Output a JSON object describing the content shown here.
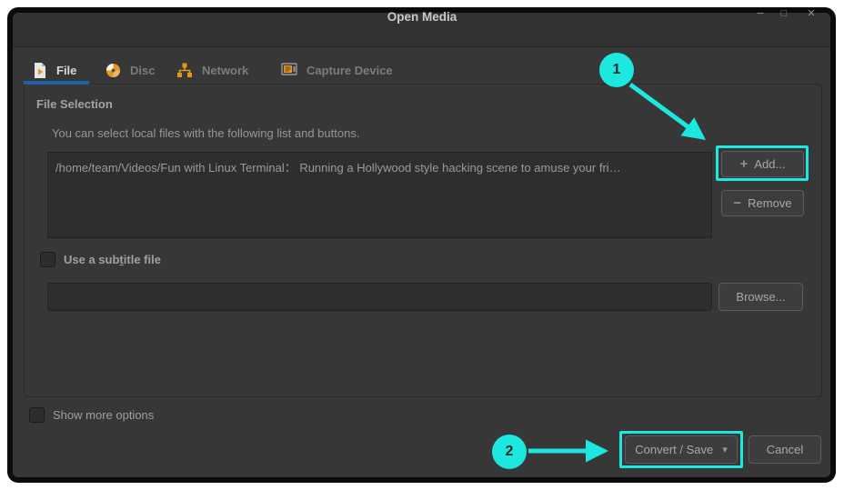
{
  "window": {
    "title": "Open Media",
    "controls": {
      "minimize_icon": "−",
      "maximize_icon": "□",
      "close_icon": "×"
    }
  },
  "tabs": [
    {
      "label": "File",
      "active": true
    },
    {
      "label": "Disc",
      "active": false
    },
    {
      "label": "Network",
      "active": false
    },
    {
      "label": "Capture Device",
      "active": false
    }
  ],
  "file_tab": {
    "heading": "File Selection",
    "description": "You can select local files with the following list and buttons.",
    "file_list": [
      "/home/team/Videos/Fun with Linux Terminal： Running a Hollywood style hacking scene to amuse your fri…"
    ],
    "add_button": {
      "icon": "+",
      "label": "Add..."
    },
    "remove_button": {
      "icon": "−",
      "label": "Remove"
    },
    "subtitle_checkbox": {
      "checked": false,
      "label_pre": "Use a sub",
      "label_mnemonic": "t",
      "label_post": "itle file"
    },
    "subtitle_input": {
      "value": "",
      "placeholder": ""
    },
    "browse_button": {
      "label": "Browse..."
    }
  },
  "footer": {
    "show_more_checkbox": {
      "checked": false,
      "label": "Show more options"
    },
    "convert_save_button": {
      "label": "Convert / Save",
      "dropdown_icon": "▾"
    },
    "cancel_button": {
      "label": "Cancel"
    }
  },
  "annotations": {
    "steps": [
      {
        "number": "1"
      },
      {
        "number": "2"
      }
    ],
    "highlight_color": "#1ce8e0"
  },
  "colors": {
    "annotation_cyan": "#1ce8e0",
    "tab_underline_blue": "#1e64a5",
    "icon_orange": "#e8971e",
    "window_background": "#373737",
    "titlebar_background": "#323232"
  }
}
